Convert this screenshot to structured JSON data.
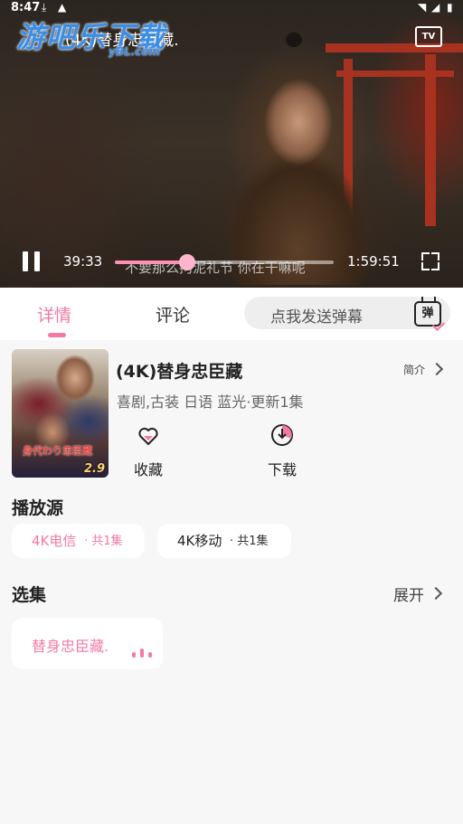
{
  "status": {
    "time": "8:47"
  },
  "player": {
    "title": "(4K)替身忠臣藏.",
    "watermark": "游吧乐下载",
    "watermark_domain": "yBL.com",
    "subtitle": "不要那么拘泥礼节 你在干嘛呢",
    "current_time": "39:33",
    "duration": "1:59:51",
    "progress_fraction": 0.33,
    "tv_label": "TV"
  },
  "tabs": [
    {
      "label": "详情",
      "active": true
    },
    {
      "label": "评论",
      "active": false
    }
  ],
  "danmu": {
    "placeholder": "点我发送弹幕",
    "icon_label": "弹"
  },
  "show": {
    "title": "(4K)替身忠臣藏",
    "intro_label": "简介",
    "meta": "喜剧,古装 日语 蓝光·更新1集",
    "poster_title": "身代わり忠臣蔵",
    "score": "2.9",
    "actions": [
      {
        "label": "收藏",
        "icon": "heart-icon"
      },
      {
        "label": "下载",
        "icon": "download-icon"
      }
    ]
  },
  "sources": {
    "heading": "播放源",
    "items": [
      {
        "name": "4K电信",
        "count": "· 共1集",
        "active": true
      },
      {
        "name": "4K移动",
        "count": "· 共1集",
        "active": false
      }
    ]
  },
  "episodes": {
    "heading": "选集",
    "expand_label": "展开",
    "items": [
      {
        "name": "替身忠臣藏.",
        "playing": true
      }
    ]
  },
  "colors": {
    "accent": "#f27aa6",
    "background": "#f7f7f7"
  }
}
